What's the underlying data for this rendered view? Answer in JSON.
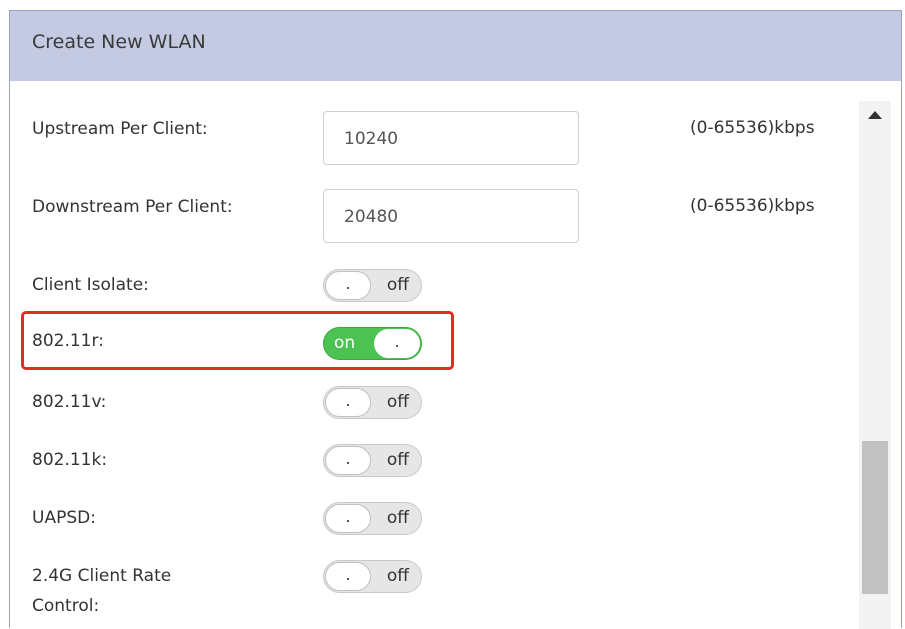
{
  "dialog": {
    "title": "Create New WLAN"
  },
  "fields": {
    "upstream": {
      "label": "Upstream Per Client:",
      "value": "10240",
      "unit": "(0-65536)kbps"
    },
    "downstream": {
      "label": "Downstream Per Client:",
      "value": "20480",
      "unit": "(0-65536)kbps"
    },
    "client_isolate": {
      "label": "Client Isolate:",
      "state": "off",
      "knob": "."
    },
    "r80211": {
      "label": "802.11r:",
      "state": "on",
      "knob": "."
    },
    "v80211": {
      "label": "802.11v:",
      "state": "off",
      "knob": "."
    },
    "k80211": {
      "label": "802.11k:",
      "state": "off",
      "knob": "."
    },
    "uapsd": {
      "label": "UAPSD:",
      "state": "off",
      "knob": "."
    },
    "rate_control": {
      "label_line1": "2.4G Client Rate",
      "label_line2": "Control:",
      "state": "off",
      "knob": "."
    }
  },
  "colors": {
    "titlebar": "#c5cae3",
    "toggle_on": "#4cc252",
    "toggle_off": "#e6e6e6",
    "highlight": "#e82a24"
  },
  "icons": {
    "scroll_up": "triangle-up"
  }
}
